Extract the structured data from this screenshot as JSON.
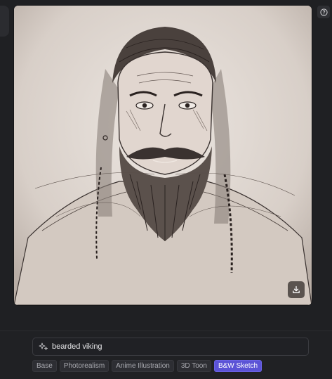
{
  "image": {
    "alt": "",
    "download_icon": "download-icon"
  },
  "toolbar": {
    "help_icon": "help-icon"
  },
  "prompt": {
    "value": "bearded viking",
    "icon": "sparkle-icon"
  },
  "styles": [
    {
      "label": "Base",
      "active": false
    },
    {
      "label": "Photorealism",
      "active": false
    },
    {
      "label": "Anime Illustration",
      "active": false
    },
    {
      "label": "3D Toon",
      "active": false
    },
    {
      "label": "B&W Sketch",
      "active": true
    }
  ],
  "colors": {
    "accent": "#5b53d6",
    "background": "#1f2023",
    "chip": "#2d2e33"
  }
}
